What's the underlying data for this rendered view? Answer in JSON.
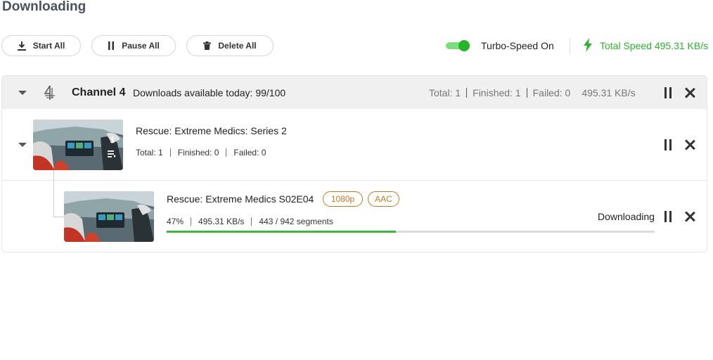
{
  "page": {
    "title": "Downloading"
  },
  "toolbar": {
    "start_all": "Start All",
    "pause_all": "Pause All",
    "delete_all": "Delete All",
    "turbo_label": "Turbo-Speed On",
    "turbo_on": true,
    "total_speed": "Total Speed 495.31 KB/s"
  },
  "colors": {
    "accent_green": "#2fb12f",
    "tag_orange": "#c07a20",
    "title_gray": "#4a5260"
  },
  "channel": {
    "name": "Channel 4",
    "available": "Downloads available today: 99/100",
    "total": "Total: 1",
    "finished": "Finished: 1",
    "failed": "Failed: 0",
    "speed": "495.31 KB/s",
    "icons": [
      "chevron-down-icon",
      "channel4-logo-icon",
      "pause-icon",
      "close-icon"
    ]
  },
  "series": {
    "title": "Rescue: Extreme Medics: Series 2",
    "episode_count": "1",
    "total": "Total: 1",
    "finished": "Finished: 0",
    "failed": "Failed: 0"
  },
  "episode": {
    "title": "Rescue: Extreme Medics S02E04",
    "resolution": "1080p",
    "audio": "AAC",
    "percent": "47%",
    "speed": "495.31 KB/s",
    "segments": "443 / 942 segments",
    "progress": 0.47,
    "status": "Downloading"
  }
}
